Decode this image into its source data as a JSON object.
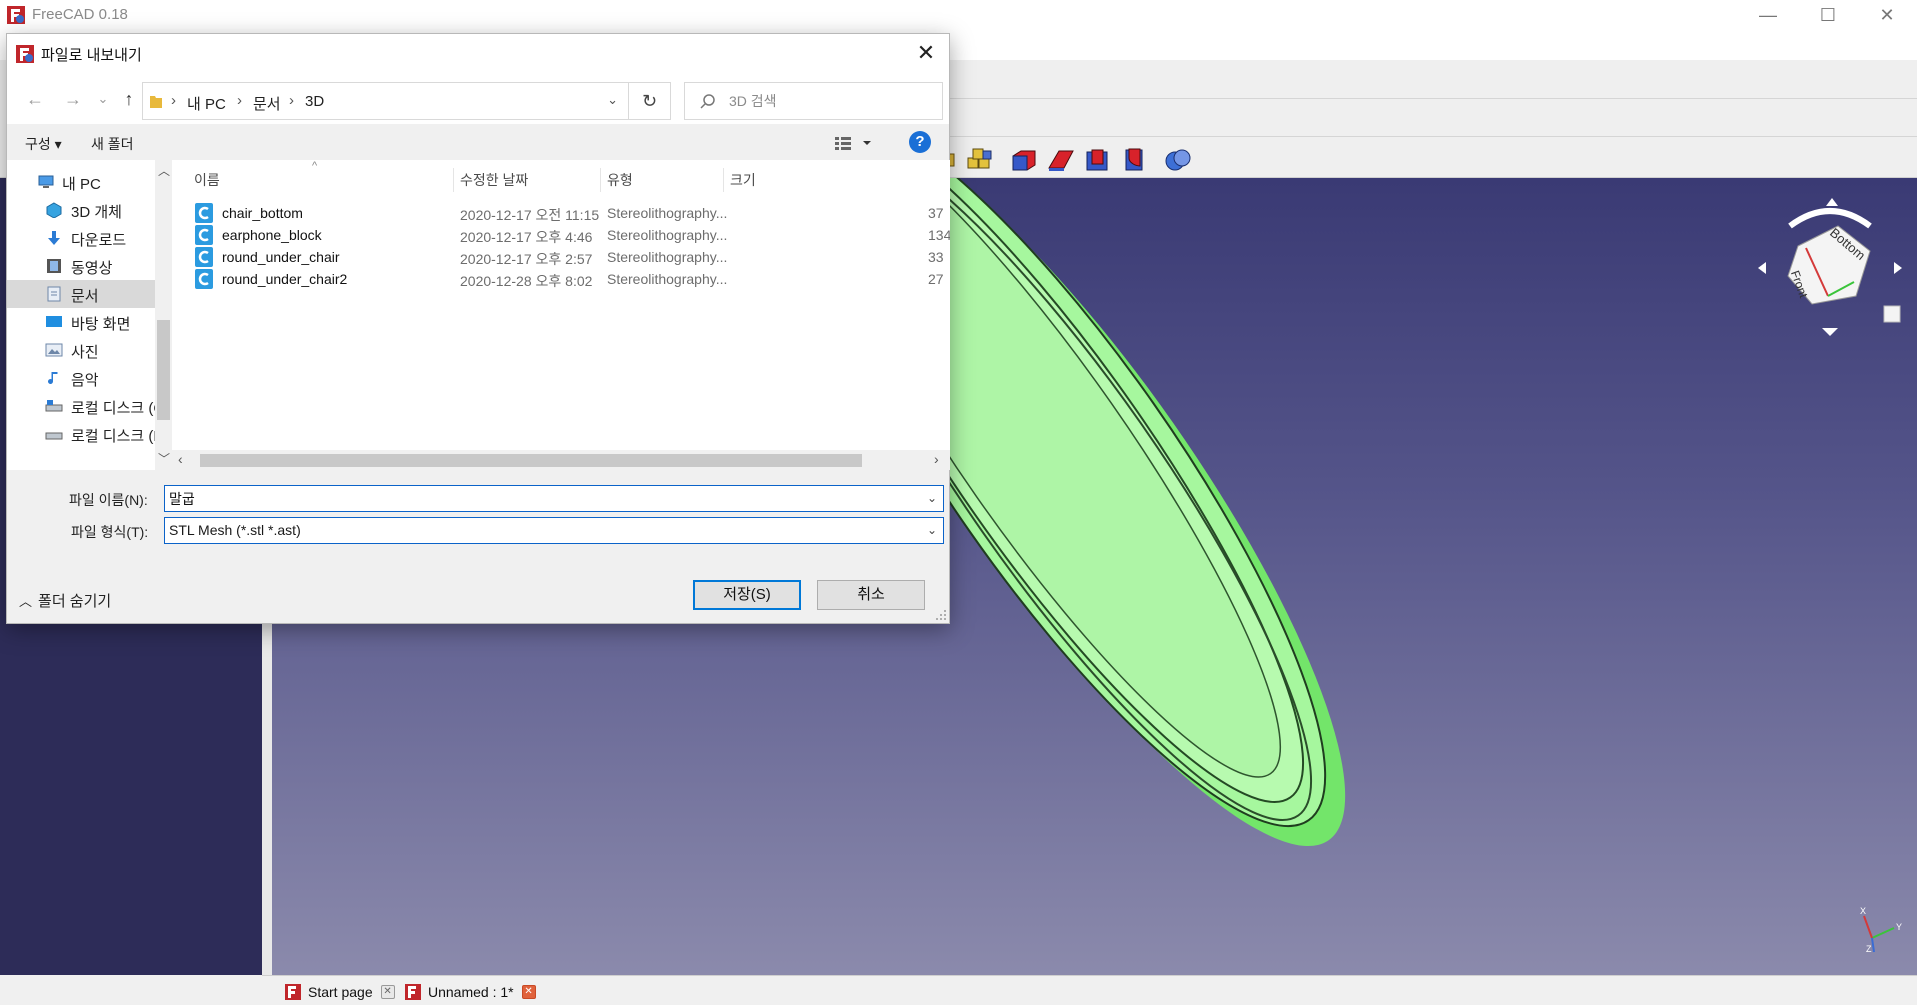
{
  "app": {
    "title": "FreeCAD 0.18"
  },
  "window_controls": {
    "minimize": "—",
    "maximize": "☐",
    "close": "✕"
  },
  "doc_tabs": [
    {
      "label": "Start page"
    },
    {
      "label": "Unnamed : 1*"
    }
  ],
  "navcube": {
    "faces": [
      "Bottom",
      "Front"
    ]
  },
  "axis": {
    "x": "X",
    "y": "Y",
    "z": "Z"
  },
  "dialog": {
    "title": "파일로 내보내기",
    "close": "✕",
    "nav": {
      "back": "←",
      "forward": "→",
      "recent": "⌄",
      "up": "↑"
    },
    "breadcrumbs": [
      "내 PC",
      "문서",
      "3D"
    ],
    "breadcrumb_separator": "›",
    "address_dropdown": "⌄",
    "refresh": "↻",
    "search_placeholder": "3D 검색",
    "commands": {
      "organize": "구성 ▾",
      "new_folder": "새 폴더",
      "help": "?"
    },
    "nav_pane": [
      {
        "label": "내 PC",
        "icon": "pc-icon"
      },
      {
        "label": "3D 개체",
        "icon": "3d-objects-icon"
      },
      {
        "label": "다운로드",
        "icon": "downloads-icon"
      },
      {
        "label": "동영상",
        "icon": "videos-icon"
      },
      {
        "label": "문서",
        "icon": "documents-icon",
        "selected": true
      },
      {
        "label": "바탕 화면",
        "icon": "desktop-icon"
      },
      {
        "label": "사진",
        "icon": "pictures-icon"
      },
      {
        "label": "음악",
        "icon": "music-icon"
      },
      {
        "label": "로컬 디스크 (C:)",
        "icon": "drive-icon"
      },
      {
        "label": "로컬 디스크 (E:)",
        "icon": "drive-icon"
      }
    ],
    "columns": {
      "name": "이름",
      "modified": "수정한 날짜",
      "type": "유형",
      "size": "크기",
      "sort_indicator": "^"
    },
    "files": [
      {
        "name": "chair_bottom",
        "modified": "2020-12-17 오전 11:15",
        "type": "Stereolithography...",
        "size": "37"
      },
      {
        "name": "earphone_block",
        "modified": "2020-12-17 오후 4:46",
        "type": "Stereolithography...",
        "size": "134"
      },
      {
        "name": "round_under_chair",
        "modified": "2020-12-17 오후 2:57",
        "type": "Stereolithography...",
        "size": "33"
      },
      {
        "name": "round_under_chair2",
        "modified": "2020-12-28 오후 8:02",
        "type": "Stereolithography...",
        "size": "27"
      }
    ],
    "filename_label": "파일 이름(N):",
    "filename_value": "말굽",
    "filetype_label": "파일 형식(T):",
    "filetype_value": "STL Mesh (*.stl *.ast)",
    "hide_folders": "폴더 숨기기",
    "save_button": "저장(S)",
    "cancel_button": "취소"
  },
  "colors": {
    "viewport_top": "#3a3a74",
    "viewport_bottom": "#8b8aac",
    "model_fill": "#a8f7a0",
    "model_edge": "#1a3a1a",
    "combo_panel": "#2d2c58",
    "accent": "#0078d7"
  }
}
